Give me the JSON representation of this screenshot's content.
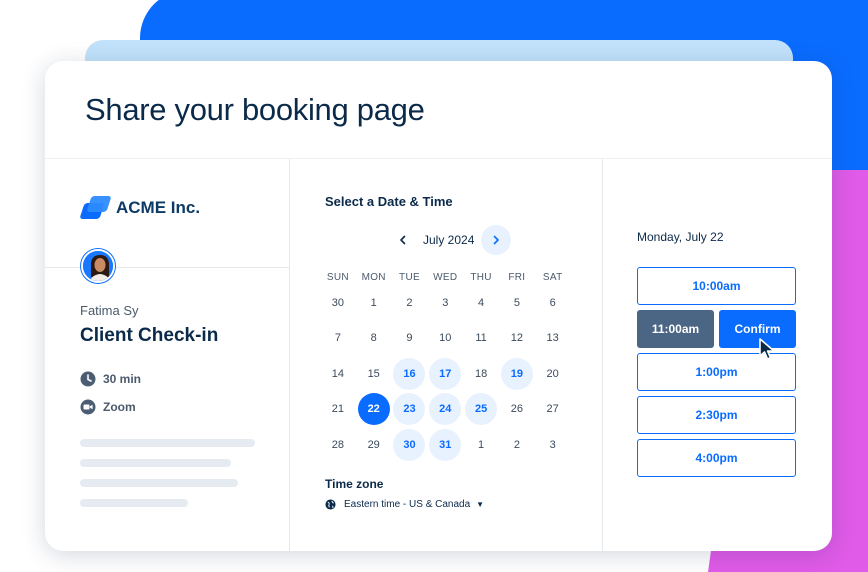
{
  "header": {
    "title": "Share your booking page"
  },
  "brand": {
    "name": "ACME Inc."
  },
  "host": {
    "name": "Fatima Sy"
  },
  "event": {
    "name": "Client Check-in",
    "duration": "30 min",
    "location": "Zoom",
    "duration_icon": "clock-icon",
    "location_icon": "video-camera-icon"
  },
  "scheduler": {
    "title": "Select a Date & Time",
    "month": "July 2024",
    "weekdays": [
      "SUN",
      "MON",
      "TUE",
      "WED",
      "THU",
      "FRI",
      "SAT"
    ],
    "weeks": [
      [
        {
          "d": "30",
          "s": "muted"
        },
        {
          "d": "1",
          "s": "muted"
        },
        {
          "d": "2",
          "s": "muted"
        },
        {
          "d": "3",
          "s": "muted"
        },
        {
          "d": "4",
          "s": "muted"
        },
        {
          "d": "5",
          "s": "muted"
        },
        {
          "d": "6",
          "s": "muted"
        }
      ],
      [
        {
          "d": "7",
          "s": "muted"
        },
        {
          "d": "8",
          "s": "muted"
        },
        {
          "d": "9",
          "s": "muted"
        },
        {
          "d": "10",
          "s": "muted"
        },
        {
          "d": "11",
          "s": "muted"
        },
        {
          "d": "12",
          "s": "muted"
        },
        {
          "d": "13",
          "s": "muted"
        }
      ],
      [
        {
          "d": "14",
          "s": "muted"
        },
        {
          "d": "15",
          "s": "muted"
        },
        {
          "d": "16",
          "s": "available"
        },
        {
          "d": "17",
          "s": "available"
        },
        {
          "d": "18",
          "s": "muted"
        },
        {
          "d": "19",
          "s": "available"
        },
        {
          "d": "20",
          "s": "muted"
        }
      ],
      [
        {
          "d": "21",
          "s": "muted"
        },
        {
          "d": "22",
          "s": "selected"
        },
        {
          "d": "23",
          "s": "available"
        },
        {
          "d": "24",
          "s": "available"
        },
        {
          "d": "25",
          "s": "available"
        },
        {
          "d": "26",
          "s": "muted"
        },
        {
          "d": "27",
          "s": "muted"
        }
      ],
      [
        {
          "d": "28",
          "s": "muted"
        },
        {
          "d": "29",
          "s": "muted"
        },
        {
          "d": "30",
          "s": "available"
        },
        {
          "d": "31",
          "s": "available"
        },
        {
          "d": "1",
          "s": "muted"
        },
        {
          "d": "2",
          "s": "muted"
        },
        {
          "d": "3",
          "s": "muted"
        }
      ]
    ],
    "timezone_label": "Time zone",
    "timezone_value": "Eastern time - US & Canada"
  },
  "times": {
    "selected_date": "Monday, July 22",
    "slots": [
      "10:00am",
      "11:00am",
      "1:00pm",
      "2:30pm",
      "4:00pm"
    ],
    "selected_slot": "11:00am",
    "confirm_label": "Confirm"
  },
  "colors": {
    "primary": "#0a6cff",
    "selected_slot_bg": "#4b6585",
    "background_accent_pink": "#e05be8",
    "available_day_bg": "#e8f1fe"
  }
}
